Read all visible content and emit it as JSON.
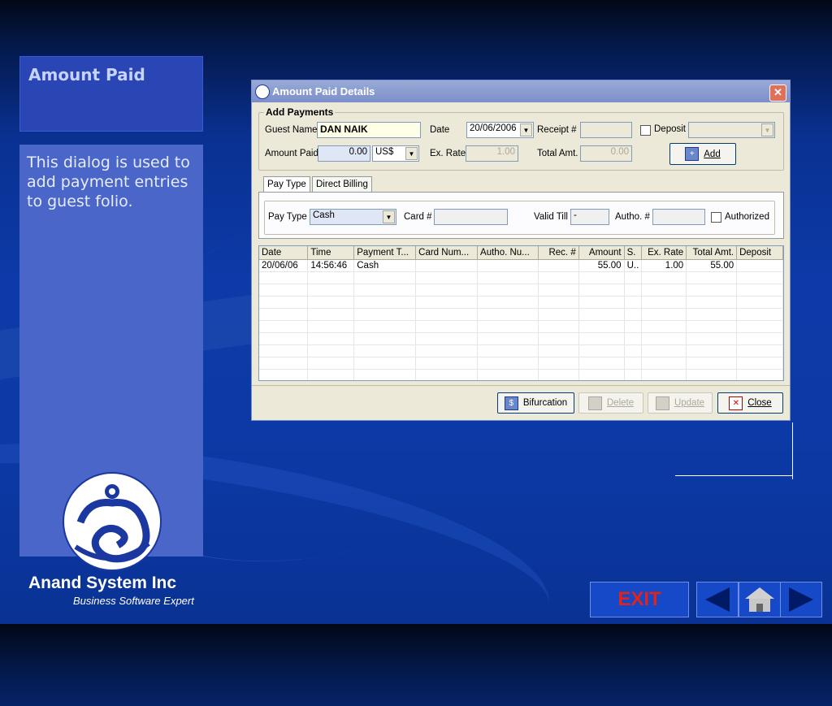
{
  "slide": {
    "title": "Amount Paid",
    "description": "This dialog is used to add payment entries to guest folio.",
    "company": "Anand System Inc",
    "tagline": "Business Software Expert",
    "exit_label": "EXIT",
    "nav": [
      "prev-arrow-icon",
      "home-icon",
      "next-arrow-icon"
    ]
  },
  "dialog": {
    "title": "Amount Paid Details",
    "add_payments": {
      "group_label": "Add Payments",
      "guest_name_label": "Guest Name",
      "guest_name": "DAN NAIK",
      "date_label": "Date",
      "date": "20/06/2006",
      "receipt_label": "Receipt #",
      "receipt": "",
      "deposit_label": "Deposit",
      "deposit": "",
      "amount_paid_label": "Amount Paid",
      "amount_paid": "0.00",
      "currency": "US$",
      "ex_rate_label": "Ex. Rate",
      "ex_rate": "1.00",
      "total_amt_label": "Total Amt.",
      "total_amt": "0.00",
      "add_button": "Add"
    },
    "tabs": [
      "Pay Type",
      "Direct Billing"
    ],
    "pay_type": {
      "pay_type_label": "Pay Type",
      "pay_type": "Cash",
      "card_label": "Card #",
      "card": "",
      "valid_till_label": "Valid Till",
      "valid_till": "-",
      "autho_label": "Autho. #",
      "autho": "",
      "authorized_label": "Authorized"
    },
    "grid": {
      "columns": [
        "Date",
        "Time",
        "Payment T...",
        "Card Num...",
        "Autho. Nu...",
        "Rec. #",
        "Amount",
        "S.",
        "Ex. Rate",
        "Total Amt.",
        "Deposit"
      ],
      "rows": [
        [
          "20/06/06",
          "14:56:46",
          "Cash",
          "",
          "",
          "",
          "55.00",
          "U..",
          "1.00",
          "55.00",
          ""
        ]
      ]
    },
    "buttons": {
      "bifurcation": "Bifurcation",
      "delete": "Delete",
      "update": "Update",
      "close": "Close"
    }
  }
}
